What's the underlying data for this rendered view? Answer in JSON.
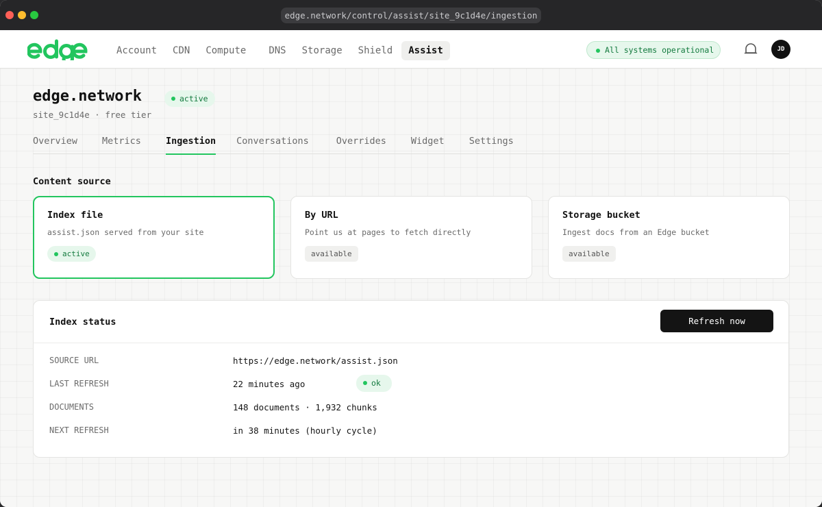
{
  "browser": {
    "url": "edge.network/control/assist/site_9c1d4e/ingestion"
  },
  "brand": {
    "logo_text": "edge",
    "accent": "#22c55e"
  },
  "nav": {
    "items": [
      {
        "label": "Account"
      },
      {
        "label": "CDN"
      },
      {
        "label": "Compute"
      },
      {
        "label": "DNS"
      },
      {
        "label": "Storage"
      },
      {
        "label": "Shield"
      },
      {
        "label": "Assist"
      }
    ],
    "active": "Assist",
    "status": "All systems operational",
    "bell_icon": "bell-icon",
    "avatar_initials": "JD"
  },
  "site": {
    "title": "edge.network",
    "status_badge": "active",
    "subtitle": "site_9c1d4e · free tier"
  },
  "tabs": {
    "items": [
      {
        "label": "Overview"
      },
      {
        "label": "Metrics"
      },
      {
        "label": "Ingestion"
      },
      {
        "label": "Conversations"
      },
      {
        "label": "Overrides"
      },
      {
        "label": "Widget"
      },
      {
        "label": "Settings"
      }
    ],
    "active": "Ingestion"
  },
  "content_source": {
    "title": "Content source",
    "cards": [
      {
        "title": "Index file",
        "desc": "assist.json served from your site",
        "badge": "active"
      },
      {
        "title": "By URL",
        "desc": "Point us at pages to fetch directly",
        "badge": "available"
      },
      {
        "title": "Storage bucket",
        "desc": "Ingest docs from an Edge bucket",
        "badge": "available"
      }
    ]
  },
  "index_status": {
    "title": "Index status",
    "refresh_label": "Refresh now",
    "rows": [
      {
        "key": "SOURCE URL",
        "value": "https://edge.network/assist.json"
      },
      {
        "key": "LAST REFRESH",
        "value": "22 minutes ago",
        "badge": "ok"
      },
      {
        "key": "DOCUMENTS",
        "value": "148 documents · 1,932 chunks"
      },
      {
        "key": "NEXT REFRESH",
        "value": "in 38 minutes (hourly cycle)"
      }
    ]
  }
}
